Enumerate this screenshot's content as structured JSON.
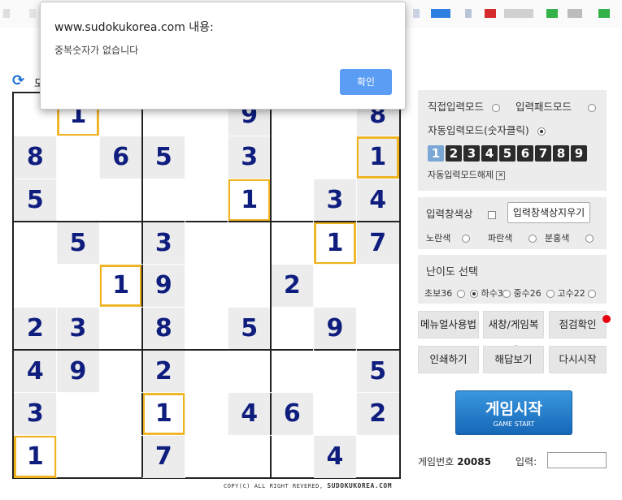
{
  "dialog": {
    "title": "www.sudokukorea.com 내용:",
    "message": "중복숫자가 없습니다",
    "ok_label": "확인"
  },
  "partial_label": "모",
  "board": {
    "givens": [
      [
        "",
        "1",
        "",
        "",
        "",
        "9",
        "",
        "",
        "8"
      ],
      [
        "8",
        "",
        "6",
        "5",
        "",
        "3",
        "",
        "",
        "1"
      ],
      [
        "5",
        "",
        "",
        "",
        "",
        "1",
        "",
        "3",
        "4"
      ],
      [
        "",
        "5",
        "",
        "3",
        "",
        "",
        "",
        "1",
        "7"
      ],
      [
        "",
        "",
        "1",
        "9",
        "",
        "",
        "2",
        "",
        ""
      ],
      [
        "2",
        "3",
        "",
        "8",
        "",
        "5",
        "",
        "9",
        ""
      ],
      [
        "4",
        "9",
        "",
        "2",
        "",
        "",
        "",
        "",
        "5"
      ],
      [
        "3",
        "",
        "",
        "1",
        "",
        "4",
        "6",
        "",
        "2"
      ],
      [
        "1",
        "",
        "",
        "7",
        "",
        "",
        "",
        "4",
        ""
      ]
    ],
    "shaded": [
      [
        0,
        0,
        0,
        0,
        0,
        1,
        0,
        0,
        1
      ],
      [
        1,
        0,
        1,
        1,
        0,
        1,
        0,
        0,
        1
      ],
      [
        1,
        0,
        0,
        0,
        0,
        0,
        0,
        1,
        1
      ],
      [
        0,
        1,
        0,
        1,
        0,
        0,
        0,
        0,
        1
      ],
      [
        0,
        0,
        0,
        1,
        0,
        0,
        1,
        0,
        0
      ],
      [
        1,
        1,
        0,
        1,
        0,
        1,
        0,
        1,
        0
      ],
      [
        1,
        1,
        0,
        1,
        0,
        0,
        0,
        0,
        1
      ],
      [
        1,
        0,
        0,
        0,
        0,
        1,
        1,
        0,
        1
      ],
      [
        0,
        0,
        0,
        1,
        0,
        0,
        0,
        1,
        0
      ]
    ],
    "highlighted": [
      [
        0,
        1,
        0,
        0,
        0,
        0,
        0,
        0,
        0
      ],
      [
        0,
        0,
        0,
        0,
        0,
        0,
        0,
        0,
        1
      ],
      [
        0,
        0,
        0,
        0,
        0,
        1,
        0,
        0,
        0
      ],
      [
        0,
        0,
        0,
        0,
        0,
        0,
        0,
        1,
        0
      ],
      [
        0,
        0,
        1,
        0,
        0,
        0,
        0,
        0,
        0
      ],
      [
        0,
        0,
        0,
        0,
        0,
        0,
        0,
        0,
        0
      ],
      [
        0,
        0,
        0,
        0,
        0,
        0,
        0,
        0,
        0
      ],
      [
        0,
        0,
        0,
        1,
        0,
        0,
        0,
        0,
        0
      ],
      [
        1,
        0,
        0,
        0,
        0,
        0,
        0,
        0,
        0
      ]
    ]
  },
  "copyright": {
    "prefix": "COPY(C) ALL RIGHT REVERED,",
    "site": "SUDOKUKOREA.COM"
  },
  "mode_panel": {
    "direct_mode": "직접입력모드",
    "pad_mode": "입력패드모드",
    "auto_mode": "자동입력모드(숫자클릭)",
    "selected_mode": "auto",
    "numbers": [
      "1",
      "2",
      "3",
      "4",
      "5",
      "6",
      "7",
      "8",
      "9"
    ],
    "active_number": "1",
    "auto_release": "자동입력모드해제"
  },
  "color_panel": {
    "label": "입력창색상",
    "clear_button": "입력창색상지우기",
    "options": [
      "노란색",
      "파란색",
      "분홍색"
    ]
  },
  "difficulty_panel": {
    "label": "난이도 선택",
    "options": [
      "초보36",
      "하수30",
      "중수26",
      "고수22"
    ],
    "selected": "하수30"
  },
  "buttons": {
    "menu_help": "메뉴얼사용법",
    "new_window": "새창/게임복제",
    "check": "점검확인",
    "print": "인쇄하기",
    "solution": "해답보기",
    "restart": "다시시작"
  },
  "start_button": {
    "main": "게임시작",
    "sub": "GAME START"
  },
  "footer": {
    "game_number_label": "게임번호",
    "game_number": "20085",
    "input_label": "입력:"
  },
  "colors": {
    "digit": "#0f1e7e",
    "highlight_border": "#efb320",
    "shaded_cell": "#ececec",
    "start_button": "#1e7bcf",
    "dialog_ok": "#5b9cf4",
    "notification_dot": "#e60012"
  }
}
